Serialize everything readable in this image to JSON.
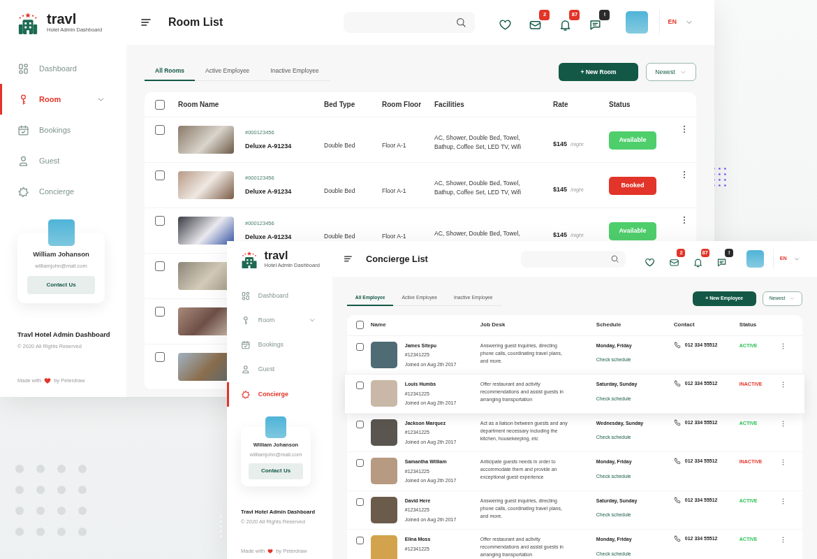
{
  "room_window": {
    "brand": {
      "name": "travl",
      "tagline": "Hotel Admin Dashboard"
    },
    "sidebar": {
      "items": [
        {
          "kind": "dashboard",
          "label": "Dashboard",
          "selected": false,
          "expandable": false
        },
        {
          "kind": "room",
          "label": "Room",
          "selected": true,
          "expandable": true
        },
        {
          "kind": "bookings",
          "label": "Bookings",
          "selected": false,
          "expandable": false
        },
        {
          "kind": "guest",
          "label": "Guest",
          "selected": false,
          "expandable": false
        },
        {
          "kind": "concierge",
          "label": "Concierge",
          "selected": false,
          "expandable": false
        }
      ]
    },
    "profile": {
      "name": "William Johanson",
      "email": "williamjohn@mail.com",
      "button": "Contact Us"
    },
    "footer": {
      "title": "Travl Hotel Admin Dashboard",
      "copyright": "© 2020 All Rights Reserved",
      "made_with": "Made with",
      "by": "by Peterdraw"
    },
    "header": {
      "title": "Room List",
      "language": "EN",
      "notifications": [
        {
          "kind": "heart"
        },
        {
          "kind": "mail",
          "count": "2",
          "color": "#e23428"
        },
        {
          "kind": "bell",
          "count": "87",
          "color": "#e23428"
        },
        {
          "kind": "chat",
          "count": "!",
          "color": "#2b2b2b"
        }
      ]
    },
    "tabs": [
      {
        "label": "All Rooms",
        "selected": true
      },
      {
        "label": "Active Employee",
        "selected": false
      },
      {
        "label": "Inactive Employee",
        "selected": false
      }
    ],
    "new_button": "+ New Room",
    "sort": "Newest",
    "table": {
      "select_all": false,
      "columns": [
        "Room Name",
        "Bed Type",
        "Room Floor",
        "Facilities",
        "Rate",
        "Status"
      ],
      "rows": [
        {
          "checked": false,
          "id": "#000123456",
          "name": "Deluxe A-91234",
          "bed": "Double Bed",
          "floor": "Floor A-1",
          "facilities": "AC, Shower, Double Bed, Towel, Bathup, Coffee Set, LED TV, Wifi",
          "rate": "$145",
          "per": "/night",
          "status": "Available",
          "booked": false
        },
        {
          "checked": false,
          "id": "#000123456",
          "name": "Deluxe A-91234",
          "bed": "Double Bed",
          "floor": "Floor A-1",
          "facilities": "AC, Shower, Double Bed, Towel, Bathup, Coffee Set, LED TV, Wifi",
          "rate": "$145",
          "per": "/night",
          "status": "Booked",
          "booked": true
        },
        {
          "checked": false,
          "id": "#000123456",
          "name": "Deluxe A-91234",
          "bed": "Double Bed",
          "floor": "Floor A-1",
          "facilities": "AC, Shower, Double Bed, Towel,",
          "rate": "$145",
          "per": "/night",
          "status": "Available",
          "booked": false
        },
        {
          "checked": false
        },
        {
          "checked": false
        },
        {
          "checked": false
        }
      ]
    }
  },
  "concierge_window": {
    "brand": {
      "name": "travl",
      "tagline": "Hotel Admin Dashboard"
    },
    "sidebar": {
      "items": [
        {
          "kind": "dashboard",
          "label": "Dashboard",
          "selected": false,
          "expandable": false
        },
        {
          "kind": "room",
          "label": "Room",
          "selected": false,
          "expandable": true
        },
        {
          "kind": "bookings",
          "label": "Bookings",
          "selected": false,
          "expandable": false
        },
        {
          "kind": "guest",
          "label": "Guest",
          "selected": false,
          "expandable": false
        },
        {
          "kind": "concierge",
          "label": "Concierge",
          "selected": true,
          "expandable": false
        }
      ]
    },
    "profile": {
      "name": "William Johanson",
      "email": "williamjohn@mail.com",
      "button": "Contact Us"
    },
    "footer": {
      "title": "Travl Hotel Admin Dashboard",
      "copyright": "© 2020 All Rights Reserved",
      "made_with": "Made with",
      "by": "by Peterdraw"
    },
    "header": {
      "title": "Concierge List",
      "language": "EN",
      "notifications": [
        {
          "kind": "heart"
        },
        {
          "kind": "mail",
          "count": "2",
          "color": "#e23428"
        },
        {
          "kind": "bell",
          "count": "87",
          "color": "#e23428"
        },
        {
          "kind": "chat",
          "count": "!",
          "color": "#2b2b2b"
        }
      ]
    },
    "tabs": [
      {
        "label": "All Employee",
        "selected": true
      },
      {
        "label": "Active Employee",
        "selected": false
      },
      {
        "label": "Inactive Employee",
        "selected": false
      }
    ],
    "new_button": "+ New Employee",
    "sort": "Newest",
    "table": {
      "select_all": false,
      "columns": [
        "Name",
        "Job Desk",
        "Schedule",
        "Contact",
        "Status"
      ],
      "rows": [
        {
          "checked": false,
          "selected": false,
          "name": "James Sitepu",
          "id": "#12341225",
          "joined": "Joined on Aug 2th 2017",
          "job": "Answering guest inquiries, directing phone calls, coordinating travel plans, and more.",
          "schedule": "Monday, Friday",
          "schedule_link": "Check schedule",
          "phone": "012 334 55512",
          "status": "ACTIVE",
          "active": true
        },
        {
          "checked": false,
          "selected": true,
          "name": "Louis Humbs",
          "id": "#12341225",
          "joined": "Joined on Aug 2th 2017",
          "job": "Offer restaurant and activity recommendations and assist guests in arranging transportation",
          "schedule": "Saturday, Sunday",
          "schedule_link": "Check schedule",
          "phone": "012 334 55512",
          "status": "INACTIVE",
          "active": false
        },
        {
          "checked": false,
          "selected": false,
          "name": "Jackson Marquez",
          "id": "#12341225",
          "joined": "Joined on Aug 2th 2017",
          "job": "Act as a liaison between guests and any department necessary including the kitchen, housekeeping, etc",
          "schedule": "Wednesday, Sunday",
          "schedule_link": "Check schedule",
          "phone": "012 334 55512",
          "status": "ACTIVE",
          "active": true
        },
        {
          "checked": false,
          "selected": false,
          "name": "Samantha William",
          "id": "#12341225",
          "joined": "Joined on Aug 2th 2017",
          "job": "Anticipate guests needs in order to accommodate them and provide an exceptional guest experience",
          "schedule": "Monday, Friday",
          "schedule_link": "Check schedule",
          "phone": "012 334 55512",
          "status": "INACTIVE",
          "active": false
        },
        {
          "checked": false,
          "selected": false,
          "name": "David Here",
          "id": "#12341225",
          "joined": "Joined on Aug 2th 2017",
          "job": "Answering guest inquiries, directing phone calls, coordinating travel plans, and more.",
          "schedule": "Saturday, Sunday",
          "schedule_link": "Check schedule",
          "phone": "012 334 55512",
          "status": "ACTIVE",
          "active": true
        },
        {
          "checked": false,
          "selected": false,
          "name": "Elina Moss",
          "id": "#12341225",
          "job": "Offer restaurant and activity recommendations and assist guests in arranging transportation",
          "schedule": "Monday, Friday",
          "schedule_link": "Check schedule",
          "phone": "012 334 55512",
          "status": "ACTIVE",
          "active": true
        }
      ]
    }
  }
}
